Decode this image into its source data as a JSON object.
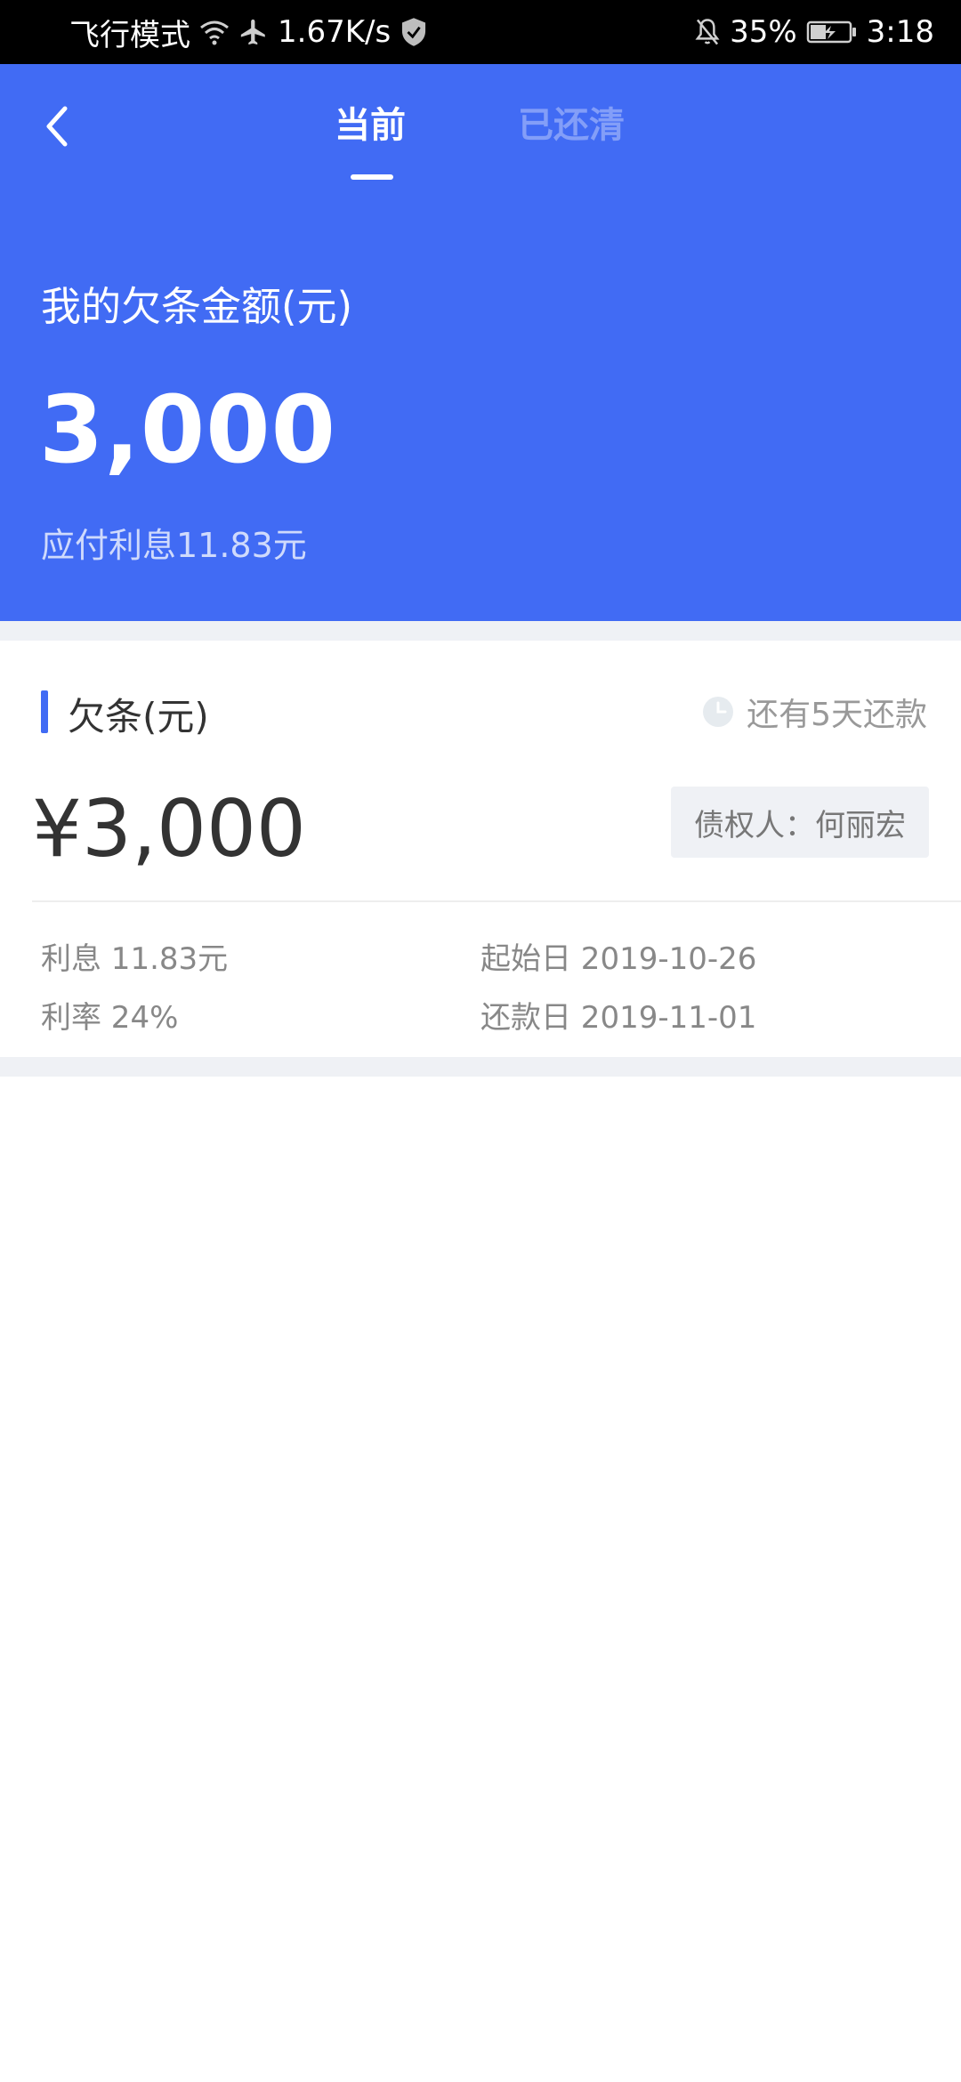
{
  "status_bar": {
    "airplane_mode_text": "飞行模式",
    "network_speed": "1.67K/s",
    "battery_percent": "35%",
    "time": "3:18"
  },
  "header": {
    "tabs": [
      {
        "label": "当前",
        "active": true
      },
      {
        "label": "已还清",
        "active": false
      }
    ],
    "debt_label": "我的欠条金额(元)",
    "debt_amount": "3,000",
    "interest_line": "应付利息11.83元"
  },
  "card": {
    "title": "欠条(元)",
    "due_text": "还有5天还款",
    "amount": "¥3,000",
    "creditor": "债权人：何丽宏",
    "interest": "利息 11.83元",
    "rate": "利率 24%",
    "start_date": "起始日 2019-10-26",
    "repay_date": "还款日 2019-11-01"
  },
  "colors": {
    "primary": "#416bf4",
    "background_gray": "#eff1f5",
    "text_dark": "#333333",
    "text_muted": "#888888"
  },
  "icons": [
    "wifi-icon",
    "airplane-icon",
    "shield-icon",
    "mute-bell-icon",
    "battery-icon",
    "back-arrow-icon",
    "clock-icon"
  ]
}
